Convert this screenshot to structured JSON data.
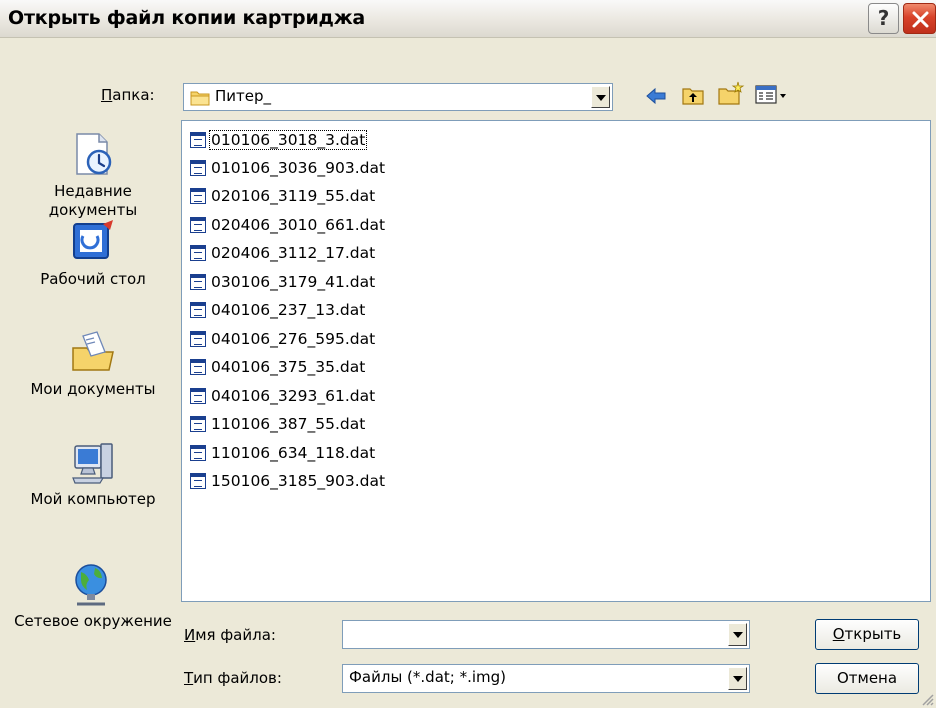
{
  "window": {
    "title": "Открыть файл копии картриджа",
    "help_label": "?"
  },
  "folder_row": {
    "label": "Папка:",
    "label_hotkey": "П",
    "label_rest": "апка:",
    "current_folder": "Питер_"
  },
  "places": [
    {
      "label": "Недавние документы",
      "icon": "recent-documents-icon"
    },
    {
      "label": "Рабочий стол",
      "icon": "desktop-icon"
    },
    {
      "label": "Мои документы",
      "icon": "my-documents-icon"
    },
    {
      "label": "Мой компьютер",
      "icon": "my-computer-icon"
    },
    {
      "label": "Сетевое окружение",
      "icon": "network-places-icon"
    }
  ],
  "files": [
    "010106_3018_3.dat",
    "010106_3036_903.dat",
    "020106_3119_55.dat",
    "020406_3010_661.dat",
    "020406_3112_17.dat",
    "030106_3179_41.dat",
    "040106_237_13.dat",
    "040106_276_595.dat",
    "040106_375_35.dat",
    "040106_3293_61.dat",
    "110106_387_55.dat",
    "110106_634_118.dat",
    "150106_3185_903.dat"
  ],
  "filename_row": {
    "label_hotkey": "И",
    "label_rest": "мя файла:",
    "value": ""
  },
  "filetype_row": {
    "label_hotkey": "Т",
    "label_rest": "ип файлов:",
    "value": "Файлы (*.dat; *.img)"
  },
  "buttons": {
    "open_hotkey": "О",
    "open_rest": "ткрыть",
    "cancel": "Отмена"
  },
  "colors": {
    "list_border": "#7f9db9",
    "dialog_bg": "#ece9d8",
    "close_red": "#d8432a"
  }
}
